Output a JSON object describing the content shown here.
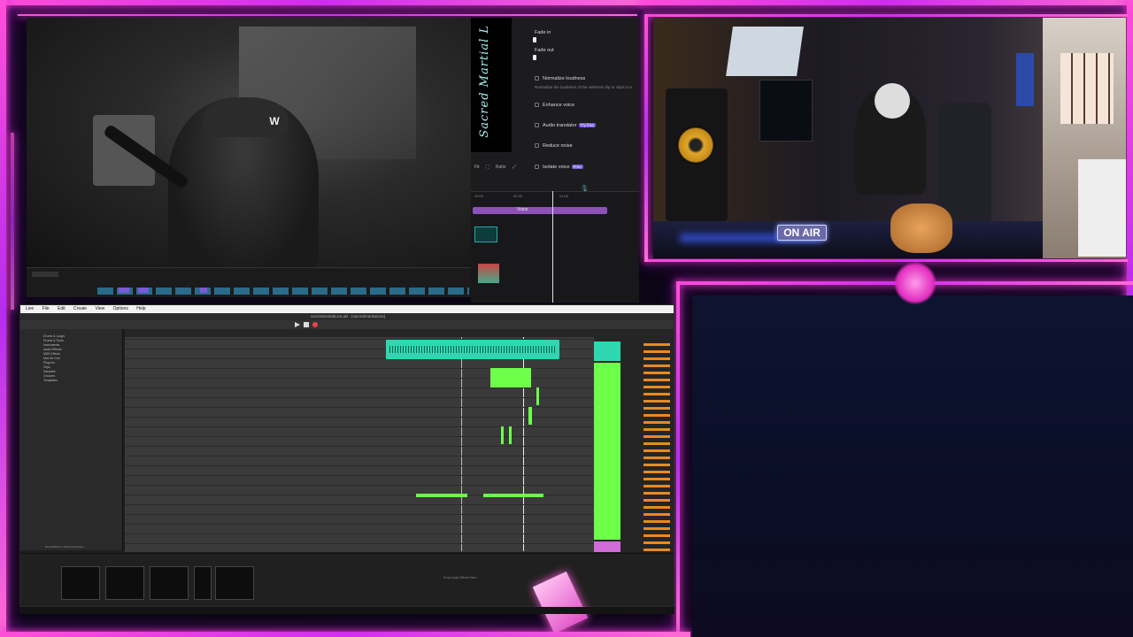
{
  "overlay": {
    "accent": "#ff4fd8",
    "accent2": "#b21fd6",
    "panel_bg": "#0e1430"
  },
  "editor": {
    "title": "Sacred Martial L",
    "fade_in": "Fade in",
    "fade_out": "Fade out",
    "normalize": "Normalize loudness",
    "normalize_desc": "Normalize the loudness of the selected clip or clips to a",
    "enhance": "Enhance voice",
    "translator": "Audio translator",
    "translator_badge": "Try free",
    "reduce": "Reduce noise",
    "isolate": "Isolate voice",
    "isolate_badge": "Free",
    "fit": "Fit",
    "ratio": "Ratio",
    "clip_label": "Voice",
    "tc1": "00:00",
    "tc2": "00:30",
    "tc3": "01:00"
  },
  "ableton": {
    "menu": [
      "Live",
      "File",
      "Edit",
      "Create",
      "View",
      "Options",
      "Help"
    ],
    "title": "sacredmartialLive.als - [sacredmartialLive]",
    "browser": [
      "Drums & Loops",
      "Drums & Tools",
      "Instruments",
      "Audio Effects",
      "MIDI Effects",
      "Max for Live",
      "Plug-Ins",
      "Clips",
      "Samples",
      "Grooves",
      "Templates"
    ],
    "drop_hint": "Drop Effects or Instruments Here",
    "status": "Drop Audio Effects Here"
  },
  "studio": {
    "on_air": "ON AIR"
  }
}
